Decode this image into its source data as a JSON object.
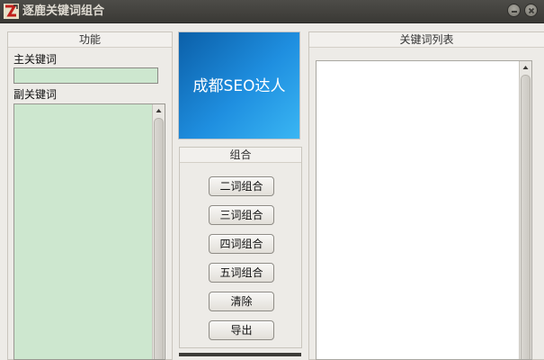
{
  "window": {
    "title": "逐鹿关键词组合",
    "icon": "app-logo-icon",
    "controls": [
      "minimize-icon",
      "close-icon"
    ]
  },
  "function_panel": {
    "header": "功能",
    "main_keyword_label": "主关键词",
    "main_keyword_value": "",
    "sub_keyword_label": "副关键词",
    "sub_keyword_value": ""
  },
  "banner": {
    "text": "成都SEO达人"
  },
  "combine_panel": {
    "header": "组合",
    "buttons": {
      "two": "二词组合",
      "three": "三词组合",
      "four": "四词组合",
      "five": "五词组合",
      "clear": "清除",
      "export": "导出"
    }
  },
  "keyword_list_panel": {
    "header": "关键词列表",
    "items": []
  },
  "colors": {
    "input_bg": "#cde7cf",
    "banner_blue": "#1f8fe0",
    "titlebar": "#3c3b37"
  }
}
